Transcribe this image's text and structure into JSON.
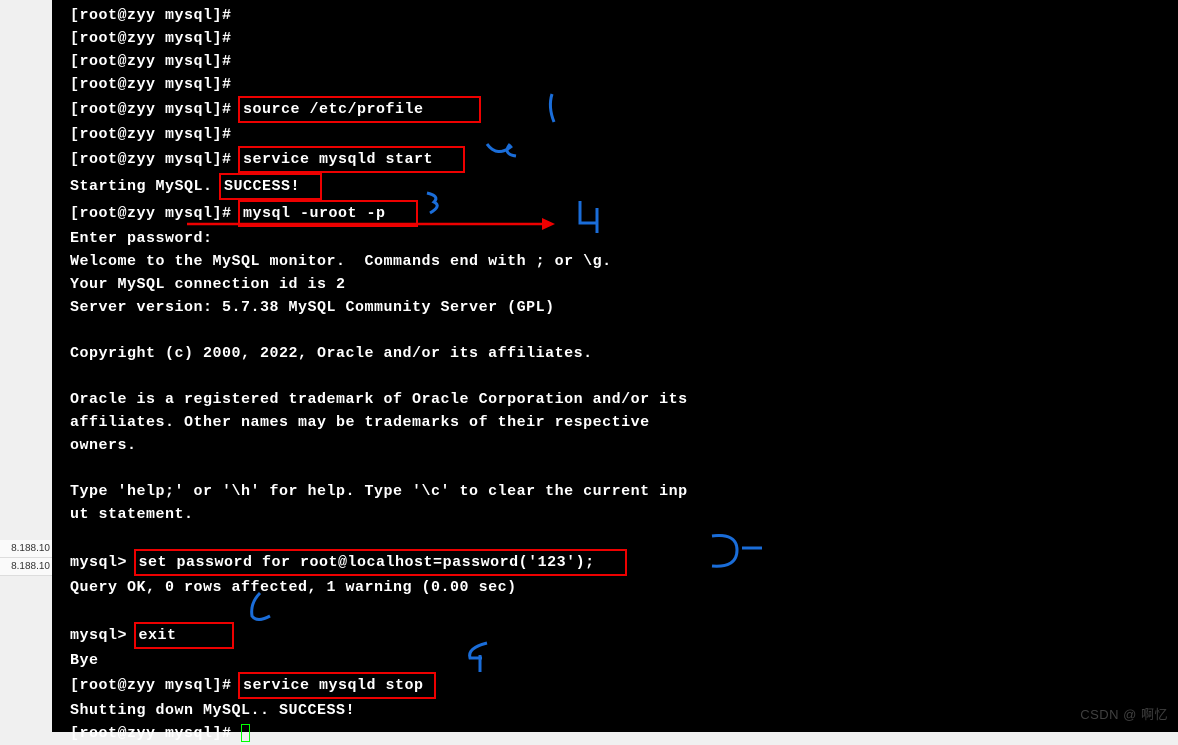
{
  "sidebar": {
    "items": [
      "8.188.10",
      "8.188.10"
    ]
  },
  "terminal": {
    "prompt": "[root@zyy mysql]#",
    "mysql_prompt": "mysql>",
    "lines": {
      "empty1": "[root@zyy mysql]#",
      "empty2": "[root@zyy mysql]#",
      "empty3": "[root@zyy mysql]#",
      "empty4": "[root@zyy mysql]#",
      "cmd1_prefix": "[root@zyy mysql]# ",
      "cmd1": "source /etc/profile",
      "empty5": "[root@zyy mysql]#",
      "cmd2_prefix": "[root@zyy mysql]# ",
      "cmd2": "service mysqld start",
      "starting": "Starting MySQL. ",
      "success": "SUCCESS!",
      "cmd3_prefix": "[root@zyy mysql]# ",
      "cmd3": "mysql -uroot -p",
      "enter_pw": "Enter password:",
      "welcome": "Welcome to the MySQL monitor.  Commands end with ; or \\g.",
      "conn_id": "Your MySQL connection id is 2",
      "server_ver": "Server version: 5.7.38 MySQL Community Server (GPL)",
      "copyright": "Copyright (c) 2000, 2022, Oracle and/or its affiliates.",
      "oracle1": "Oracle is a registered trademark of Oracle Corporation and/or its",
      "oracle2": "affiliates. Other names may be trademarks of their respective",
      "oracle3": "owners.",
      "help1": "Type 'help;' or '\\h' for help. Type '\\c' to clear the current inp",
      "help2": "ut statement.",
      "setpw_prefix": "mysql> ",
      "setpw": "set password for root@localhost=password('123');",
      "query_ok": "Query OK, 0 rows affected, 1 warning (0.00 sec)",
      "exit_prefix": "mysql> ",
      "exit": "exit",
      "bye": "Bye",
      "cmd4_prefix": "[root@zyy mysql]# ",
      "cmd4": "service mysqld stop",
      "shutdown": "Shutting down MySQL.. SUCCESS!",
      "final_prompt": "[root@zyy mysql]# "
    },
    "annotations": {
      "a1": "1",
      "a2": "2",
      "a3": "3",
      "a4": "4",
      "a5": "5",
      "a6": "6",
      "a7": "7"
    }
  },
  "watermark": "CSDN @ 啊忆"
}
